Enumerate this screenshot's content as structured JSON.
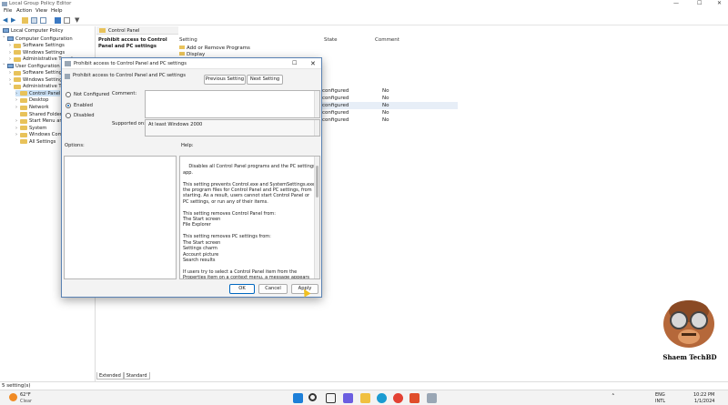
{
  "window": {
    "title": "Local Group Policy Editor",
    "controls": [
      "—",
      "☐",
      "✕"
    ]
  },
  "menu": [
    "File",
    "Action",
    "View",
    "Help"
  ],
  "tree": {
    "root": "Local Computer Policy",
    "items": [
      {
        "label": "Computer Configuration",
        "level": 1,
        "chev": "˅",
        "type": "pc"
      },
      {
        "label": "Software Settings",
        "level": 2,
        "chev": "›",
        "type": "folder"
      },
      {
        "label": "Windows Settings",
        "level": 2,
        "chev": "›",
        "type": "folder"
      },
      {
        "label": "Administrative Templ",
        "level": 2,
        "chev": "›",
        "type": "folder"
      },
      {
        "label": "User Configuration",
        "level": 1,
        "chev": "˅",
        "type": "pc"
      },
      {
        "label": "Software Settings",
        "level": 2,
        "chev": "›",
        "type": "folder"
      },
      {
        "label": "Windows Settings",
        "level": 2,
        "chev": "›",
        "type": "folder"
      },
      {
        "label": "Administrative Tem",
        "level": 2,
        "chev": "˅",
        "type": "folder"
      },
      {
        "label": "Control Panel",
        "level": 3,
        "chev": "›",
        "type": "folder",
        "selected": true
      },
      {
        "label": "Desktop",
        "level": 3,
        "chev": "›",
        "type": "folder"
      },
      {
        "label": "Network",
        "level": 3,
        "chev": "›",
        "type": "folder"
      },
      {
        "label": "Shared Folders",
        "level": 3,
        "chev": "",
        "type": "folder"
      },
      {
        "label": "Start Menu and",
        "level": 3,
        "chev": "›",
        "type": "folder"
      },
      {
        "label": "System",
        "level": 3,
        "chev": "›",
        "type": "folder"
      },
      {
        "label": "Windows Comp",
        "level": 3,
        "chev": "›",
        "type": "folder"
      },
      {
        "label": "All Settings",
        "level": 3,
        "chev": "",
        "type": "folder"
      }
    ]
  },
  "right": {
    "header": "Control Panel",
    "description_title": "Prohibit access to Control Panel and PC settings",
    "columns": {
      "setting": "Setting",
      "state": "State",
      "comment": "Comment"
    },
    "settings": [
      "Add or Remove Programs",
      "Display"
    ],
    "rows": [
      {
        "state": "configured",
        "comment": "No"
      },
      {
        "state": "configured",
        "comment": "No"
      },
      {
        "state": "configured",
        "comment": "No"
      },
      {
        "state": "configured",
        "comment": "No"
      },
      {
        "state": "configured",
        "comment": "No"
      }
    ]
  },
  "tabs": [
    "Extended",
    "Standard"
  ],
  "status": "5 setting(s)",
  "dialog": {
    "title": "Prohibit access to Control Panel and PC settings",
    "policy_name": "Prohibit access to Control Panel and PC settings",
    "prev_button": "Previous Setting",
    "next_button": "Next Setting",
    "options": {
      "not_configured": "Not Configured",
      "enabled": "Enabled",
      "disabled": "Disabled",
      "selected": "enabled"
    },
    "comment_label": "Comment:",
    "supported_label": "Supported on:",
    "supported_value": "At least Windows 2000",
    "options_label": "Options:",
    "help_label": "Help:",
    "help_text": "Disables all Control Panel programs and the PC settings app.\n\nThis setting prevents Control.exe and SystemSettings.exe, the program files for Control Panel and PC settings, from starting. As a result, users cannot start Control Panel or PC settings, or run any of their items.\n\nThis setting removes Control Panel from:\nThe Start screen\nFile Explorer\n\nThis setting removes PC settings from:\nThe Start screen\nSettings charm\nAccount picture\nSearch results\n\nIf users try to select a Control Panel item from the Properties item on a context menu, a message appears explaining that a setting prevents the action.",
    "ok": "OK",
    "cancel": "Cancel",
    "apply": "Apply"
  },
  "taskbar": {
    "weather_temp": "62°F",
    "weather_desc": "Clear",
    "lang": "ENG",
    "lang2": "INTL",
    "time": "10:22 PM",
    "date": "1/1/2024"
  },
  "watermark": "Shaem TechBD",
  "colors": {
    "accent": "#0067c0",
    "selection": "#cde3f7",
    "folder": "#e8c25a"
  }
}
